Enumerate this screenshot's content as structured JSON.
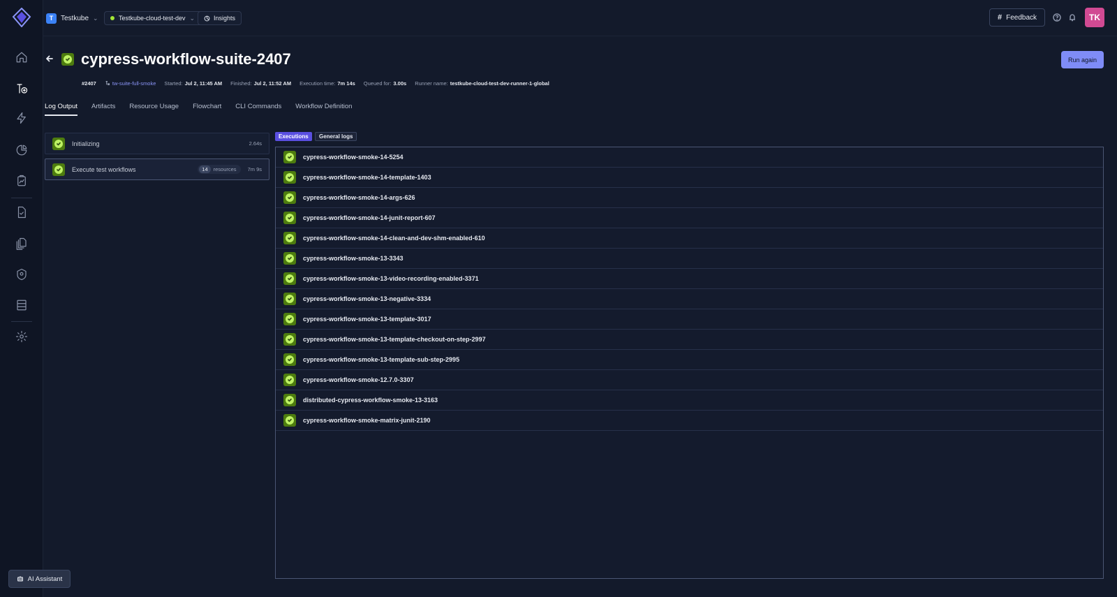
{
  "org": {
    "initial": "T",
    "name": "Testkube"
  },
  "environment": {
    "name": "Testkube-cloud-test-dev"
  },
  "insights": {
    "label": "Insights"
  },
  "feedback": {
    "label": "Feedback"
  },
  "user": {
    "initials": "TK"
  },
  "header": {
    "title": "cypress-workflow-suite-2407",
    "run_again_label": "Run again"
  },
  "meta": {
    "execution_number": "#2407",
    "workflow_link": "tw-suite-full-smoke",
    "started_label": "Started:",
    "started_value": "Jul 2, 11:45 AM",
    "finished_label": "Finished:",
    "finished_value": "Jul 2, 11:52 AM",
    "exec_time_label": "Execution time:",
    "exec_time_value": "7m 14s",
    "queued_label": "Queued for:",
    "queued_value": "3.00s",
    "runner_label": "Runner name:",
    "runner_value": "testkube-cloud-test-dev-runner-1-global"
  },
  "tabs": [
    {
      "label": "Log Output"
    },
    {
      "label": "Artifacts"
    },
    {
      "label": "Resource Usage"
    },
    {
      "label": "Flowchart"
    },
    {
      "label": "CLI Commands"
    },
    {
      "label": "Workflow Definition"
    }
  ],
  "steps": [
    {
      "name": "Initializing",
      "time": "2.64s"
    },
    {
      "name": "Execute test workflows",
      "resource_count": "14",
      "resource_label": "resources",
      "time": "7m 9s"
    }
  ],
  "segments": {
    "executions": "Executions",
    "general_logs": "General logs"
  },
  "executions": [
    {
      "name": "cypress-workflow-smoke-14-5254"
    },
    {
      "name": "cypress-workflow-smoke-14-template-1403"
    },
    {
      "name": "cypress-workflow-smoke-14-args-626"
    },
    {
      "name": "cypress-workflow-smoke-14-junit-report-607"
    },
    {
      "name": "cypress-workflow-smoke-14-clean-and-dev-shm-enabled-610"
    },
    {
      "name": "cypress-workflow-smoke-13-3343"
    },
    {
      "name": "cypress-workflow-smoke-13-video-recording-enabled-3371"
    },
    {
      "name": "cypress-workflow-smoke-13-negative-3334"
    },
    {
      "name": "cypress-workflow-smoke-13-template-3017"
    },
    {
      "name": "cypress-workflow-smoke-13-template-checkout-on-step-2997"
    },
    {
      "name": "cypress-workflow-smoke-13-template-sub-step-2995"
    },
    {
      "name": "cypress-workflow-smoke-12.7.0-3307"
    },
    {
      "name": "distributed-cypress-workflow-smoke-13-3163"
    },
    {
      "name": "cypress-workflow-smoke-matrix-junit-2190"
    }
  ],
  "ai_assistant": {
    "label": "AI Assistant"
  },
  "colors": {
    "background": "#131a2b",
    "accent": "#7f8cf7",
    "success": "#bef264",
    "avatar": "#d14a93"
  }
}
